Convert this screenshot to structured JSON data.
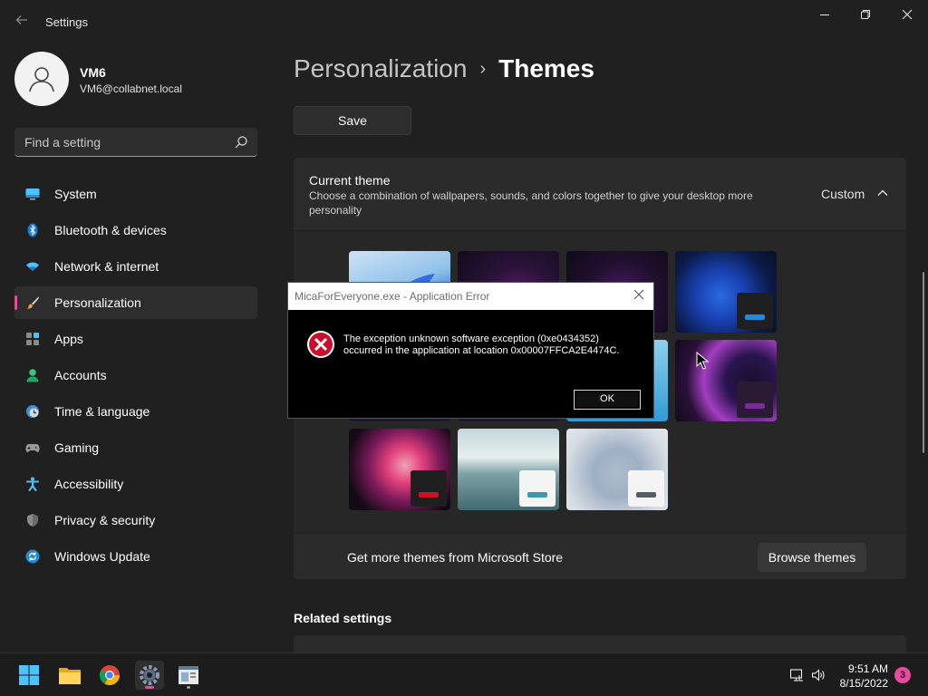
{
  "window": {
    "title": "Settings"
  },
  "user": {
    "name": "VM6",
    "email": "VM6@collabnet.local"
  },
  "search": {
    "placeholder": "Find a setting"
  },
  "sidebar": {
    "items": [
      {
        "label": "System",
        "icon": "monitor-icon"
      },
      {
        "label": "Bluetooth & devices",
        "icon": "bluetooth-icon"
      },
      {
        "label": "Network & internet",
        "icon": "wifi-icon"
      },
      {
        "label": "Personalization",
        "icon": "brush-icon",
        "active": true
      },
      {
        "label": "Apps",
        "icon": "apps-icon"
      },
      {
        "label": "Accounts",
        "icon": "person-icon"
      },
      {
        "label": "Time & language",
        "icon": "clock-globe-icon"
      },
      {
        "label": "Gaming",
        "icon": "gamepad-icon"
      },
      {
        "label": "Accessibility",
        "icon": "accessibility-icon"
      },
      {
        "label": "Privacy & security",
        "icon": "shield-icon"
      },
      {
        "label": "Windows Update",
        "icon": "update-icon"
      }
    ]
  },
  "header": {
    "parent": "Personalization",
    "separator": "›",
    "current": "Themes"
  },
  "toolbar": {
    "save_label": "Save"
  },
  "current_theme": {
    "title": "Current theme",
    "description": "Choose a combination of wallpapers, sounds, and colors together to give your desktop more personality",
    "value": "Custom"
  },
  "store": {
    "label": "Get more themes from Microsoft Store",
    "button": "Browse themes"
  },
  "related": {
    "title": "Related settings"
  },
  "dialog": {
    "title": "MicaForEveryone.exe - Application Error",
    "message_line1": "The exception unknown software exception (0xe0434352)",
    "message_line2": "occurred in the application at location 0x00007FFCA2E4474C.",
    "ok_label": "OK"
  },
  "taskbar": {
    "apps": [
      "windows-start-icon",
      "file-explorer-icon",
      "chrome-icon",
      "settings-icon",
      "app-window-icon"
    ],
    "time": "9:51 AM",
    "date": "8/15/2022",
    "notification_count": "3"
  },
  "colors": {
    "accent": "#e84aa0",
    "background": "#202020",
    "card": "#2b2b2b"
  }
}
